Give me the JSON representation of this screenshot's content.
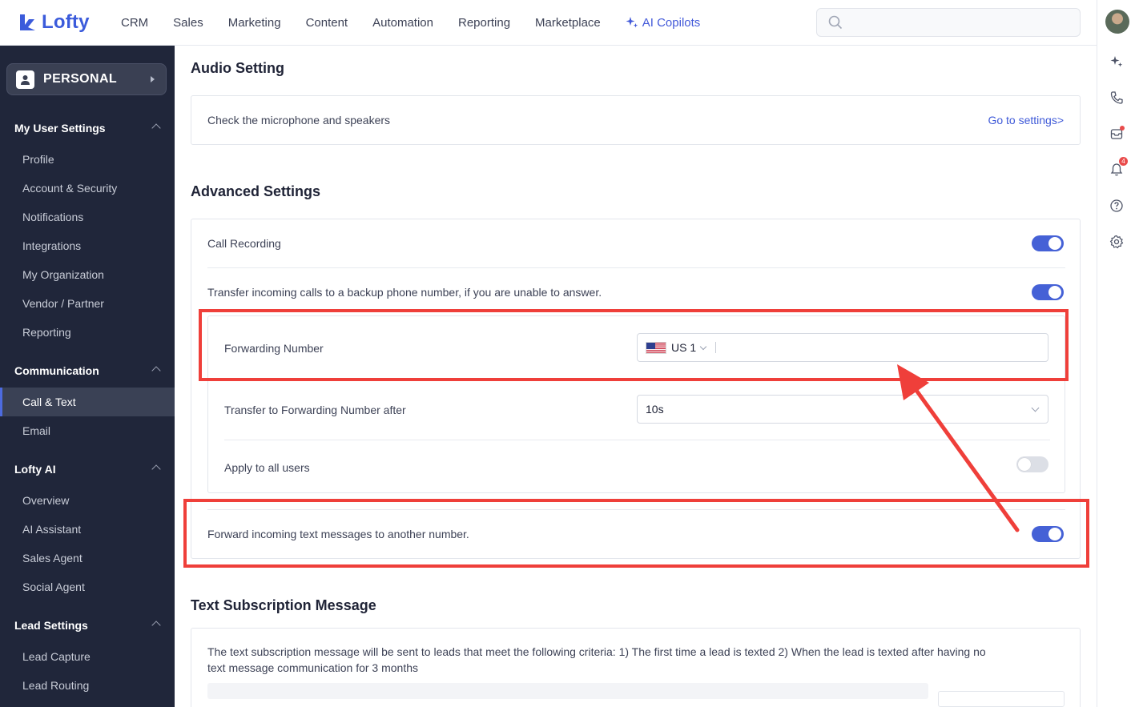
{
  "brand": {
    "name": "Lofty",
    "color": "#3b5bdb"
  },
  "topnav": {
    "items": [
      "CRM",
      "Sales",
      "Marketing",
      "Content",
      "Automation",
      "Reporting",
      "Marketplace"
    ],
    "ai_label": "AI Copilots",
    "search_placeholder": ""
  },
  "right_rail": {
    "notification_count": "4",
    "icons": [
      "sparkle-icon",
      "phone-icon",
      "inbox-icon",
      "bell-icon",
      "help-icon",
      "gear-icon"
    ]
  },
  "sidebar": {
    "personal_label": "PERSONAL",
    "sections": [
      {
        "title": "My User Settings",
        "items": [
          "Profile",
          "Account & Security",
          "Notifications",
          "Integrations",
          "My Organization",
          "Vendor / Partner",
          "Reporting"
        ]
      },
      {
        "title": "Communication",
        "items": [
          "Call & Text",
          "Email"
        ],
        "active": "Call & Text"
      },
      {
        "title": "Lofty AI",
        "items": [
          "Overview",
          "AI Assistant",
          "Sales Agent",
          "Social Agent"
        ]
      },
      {
        "title": "Lead Settings",
        "items": [
          "Lead Capture",
          "Lead Routing"
        ]
      }
    ]
  },
  "audio": {
    "title": "Audio Setting",
    "description": "Check the microphone and speakers",
    "link": "Go to settings>"
  },
  "advanced": {
    "title": "Advanced Settings",
    "call_recording": {
      "label": "Call Recording",
      "enabled": true
    },
    "transfer_backup": {
      "label": "Transfer incoming calls to a backup phone number, if you are unable to answer.",
      "enabled": true
    },
    "forwarding_number": {
      "label": "Forwarding Number",
      "country": "US",
      "code": "1",
      "value": ""
    },
    "transfer_after": {
      "label": "Transfer to Forwarding Number after",
      "value": "10s"
    },
    "apply_all": {
      "label": "Apply to all users",
      "enabled": false
    },
    "forward_texts": {
      "label": "Forward incoming text messages to another number.",
      "enabled": true
    }
  },
  "subscription": {
    "title": "Text Subscription Message",
    "description_line1": "The text subscription message will be sent to leads that meet the following criteria: 1) The first time a lead is texted 2) When the lead is texted after having no",
    "description_line2": "text message communication for 3 months"
  },
  "colors": {
    "annotation": "#ef3f3a",
    "toggle_on": "#4561d6",
    "sidebar_bg": "#20263a"
  }
}
